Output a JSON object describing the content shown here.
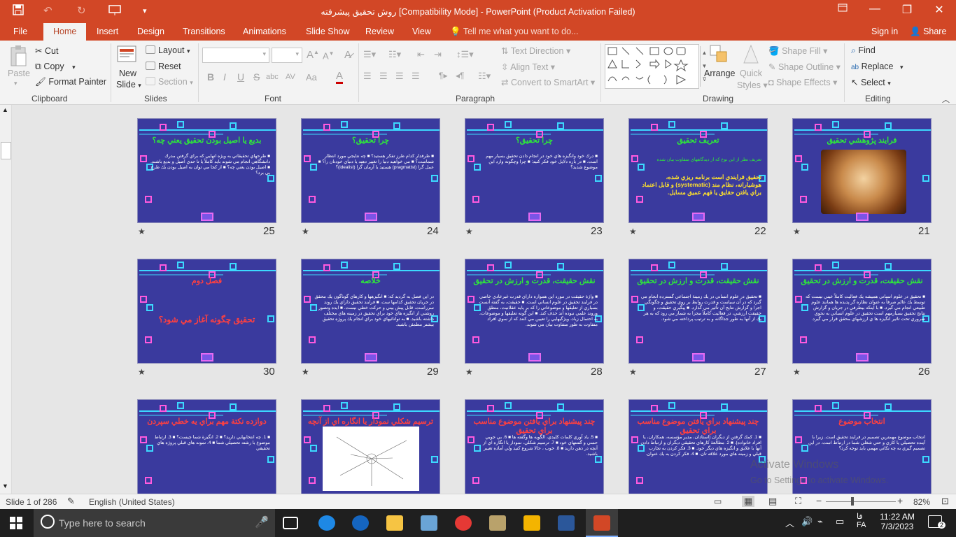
{
  "titlebar": {
    "title": "روش تحقیق پیشرفته [Compatibility Mode] - PowerPoint (Product Activation Failed)",
    "save_icon": "save-icon",
    "undo_icon": "undo-icon",
    "redo_icon": "redo-icon",
    "presenter_icon": "present-icon",
    "customize_icon": "chevron-down-icon",
    "ribbon_display": "□",
    "minimize": "—",
    "restore": "❐",
    "close": "✕"
  },
  "tabs": [
    "File",
    "Home",
    "Insert",
    "Design",
    "Transitions",
    "Animations",
    "Slide Show",
    "Review",
    "View"
  ],
  "active_tab": "Home",
  "tell_me": "Tell me what you want to do...",
  "signin": "Sign in",
  "share": "Share",
  "ribbon": {
    "clipboard": {
      "paste": "Paste",
      "cut": "Cut",
      "copy": "Copy",
      "format_painter": "Format Painter",
      "label": "Clipboard"
    },
    "slides": {
      "new_slide": "New",
      "new_slide2": "Slide",
      "layout": "Layout",
      "reset": "Reset",
      "section": "Section",
      "label": "Slides"
    },
    "font": {
      "label": "Font",
      "bold": "B",
      "italic": "I",
      "underline": "U",
      "strike": "S",
      "shadow": "abc",
      "spacing": "AV",
      "case": "Aa",
      "color": "A",
      "grow": "A",
      "shrink": "A"
    },
    "paragraph": {
      "label": "Paragraph",
      "text_direction": "Text Direction",
      "align_text": "Align Text",
      "convert": "Convert to SmartArt"
    },
    "drawing": {
      "label": "Drawing",
      "arrange": "Arrange",
      "quick_styles": "Quick",
      "quick_styles2": "Styles",
      "fill": "Shape Fill",
      "outline": "Shape Outline",
      "effects": "Shape Effects"
    },
    "editing": {
      "label": "Editing",
      "find": "Find",
      "replace": "Replace",
      "select": "Select"
    }
  },
  "slides": [
    {
      "num": "25",
      "title": "بديع يا اصيل بودن تحقيق يعني چه؟",
      "body": "■ طرحهاي تحقيقاتي به ويژه انهايي كه براي گرفتن مدرك دانشگاهي انجام مي شوند بايد كاملاً يا تا حدي اصيل و بديع باشند. ■ اصيل بودن يعني چه؟ ■ از كجا مي توان به اصيل بودن يك طرح پي برد؟"
    },
    {
      "num": "24",
      "title": "چرا تحقيق؟",
      "body": "■ طرفدار كدام طرز تفكر هستيد؟ ■ چه نتايجي مورد انتظار شماست؟ ■ مي خواهيد دنيا را تغيير دهيد يا دنياي خودتان را؟ ■ عمل گرا (pragmatist) هستيد يا آرمان گرا (idealist)؟"
    },
    {
      "num": "23",
      "title": "چرا تحقيق؟",
      "body": "■ درك خود وانگيزه هاي خود در انجام دادن تحقيق بسيار مهم است. ■ در باره دلايل خود فكر كنيد: ■ چرا وچگونه وارد اين موضوع شديد؟"
    },
    {
      "num": "22",
      "title": "تعريف تحقيق",
      "body": "تحقيق فرايندي است برنامه ريزي شده، هوشيارانه، نظام مند (systematic) و قابل اعتماد براي يافتن حقايق يا فهم عميق مسايل.",
      "yellow": true,
      "sub": "تعريف نظر از اين نوع كه از ديدگاههاي متفاوت بيان شده"
    },
    {
      "num": "21",
      "title": "فرايند پژوهشي تحقيق",
      "image": true
    },
    {
      "num": "30",
      "title": "فصل دوم",
      "body": "تحقيق چگونه آغاز مي شود؟",
      "red": true,
      "big": true
    },
    {
      "num": "29",
      "title": "خلاصه",
      "body": "در اين فصل به گرديد كه: ■ انگيزهها و كارهاي گوناگون يك محقق در جريان تحقيق كدامها ست. ■ فرايند تحقيق داراي يك روند سرراست، قابل پيش بيني و حركت خطي نيست. ■ ايده وتصور روشني از انگيزه هاي خود براي تحقيق در زمينه هاي مختلف داشته باشيد. ■ به توانائيهاي خود براي انجام يك پروژه تحقيق بيشتر مطمئن باشيد."
    },
    {
      "num": "28",
      "title": "نقش حقيقت، قدرت و ارزش در تحقيق",
      "body": "■ واژة حقيقت در مورد اين همواره داراي قدرت غيرعادي خاصي در فرايند تحقيق در علوم انساني است. ■ حقيقت، به گفتة آنست بسياري از تعليقها و موضوعاتي را كه بر پايه عقلانيت، منطق وروند علمي نبوده اند حذف كند. ■ اين گونه تعليقها و موضوعات، به احتمال زياد، ويژگيهايي را تعيين مي كنند كه از سوي افراد متفاوت به طور متفاوت بيان مي شوند."
    },
    {
      "num": "27",
      "title": "نقش حقيقت، قدرت و ارزش در تحقيق",
      "body": "■ تحقيق در علوم انساني در يك زمينة اجتماعي گسترده انجام مي گيرد كه در آن سياست و قدرت روابط بر روي تحقيق و چگونگي اجرا و گزارش نتايج آن تأثير مي گذارد. ■ پيگيري حقيقت، و حقيقت ارزشي، در فعاليت كاملاً مجزا به شمار مي رود كه به هر يك از آنها به طور جداگانه و به ترتيب پرداخته مي شود."
    },
    {
      "num": "26",
      "title": "نقش حقيقت، قدرت و ارزش در تحقيق",
      "body": "■ تحقيق در علوم انساني هميشه يك فعاليت كاملاً عيني نيست كه توسط يك عالم صرفاً به عنوان نظاره گر پديده ها همانند علوم طبيعي انجام مي گيرد. ■ با اينكه بيطرفي در جريان و گزارش نتايج تحقيق بسيارمهم است تحقيق در علوم انساني به نحوي ضروري تحت تاثير انگيزه ها ي ارزشهاي محقق قرار مي گيرد."
    },
    {
      "num": "",
      "title": "دوازده نكتة مهم براي يه خطي سپردن",
      "body": "■ 1. چه انتخابهايي داريد؟ ■ 2. انگيزة شما چيست؟ ■ 3. ارتباط موضوع با رشته تحصيلي شما ■ 4. نمونه هاي قبلي پروژه هاي تحقيقي",
      "red": true
    },
    {
      "num": "",
      "title": "ترسيم شكلي نمودار يا انگاره اي از آنچه در ذهن داريد",
      "diagram": true,
      "red": true
    },
    {
      "num": "",
      "title": "چند پيشنهاد براي يافتن موضوع مناسب براي تحقيق",
      "body": "■ 5. ياد آوري كلمات كليدي، الگويه ها وگفته ها ■ 6. بي جويي حسي و گفتنهاي خود ■ 7. ترسيم شكلي، نمودار يا انگاره اي از آنچه در ذهن داريد ■ 8. خوب ، حالا شروع كنيد ولي آماده تغيير باشيد.",
      "red": true
    },
    {
      "num": "",
      "title": "چند پيشنهاد براي يافتن موضوع مناسب براي تحقيق",
      "body": "■ 1. كمك گرفتن از ديگران (استادان، مدير مؤسسه، همكاران، يا افراد خانواده). ■ 2. مطالعة كارهاي تحقيقي ديگران و ارتباط دادن آنها با علايق و انگيزه هاي ديگر خود. ■ 3. فكر كردن به تجارب قبلي و زمينه هاي مورد علاقه تان. ■ 4. فكر كردن به يك عنوان.",
      "red": true
    },
    {
      "num": "",
      "title": "انتخاب موضوع",
      "body": "انتخاب موضوع مهمترين تصميم در فرايند تحقيق است. زيرا با آينده تحصيلي يا كاري و حتي شغلي شما در ارتباط است. در اين تصميم گيري به چه نكاتي مهمي بايد توجه كرد؟",
      "red": true
    }
  ],
  "watermark": {
    "line1": "Activate Windows",
    "line2": "Go to Settings to activate Windows."
  },
  "status": {
    "slide": "Slide 1 of 286",
    "language": "English (United States)",
    "zoom": "82%",
    "minus": "−",
    "plus": "+"
  },
  "taskbar": {
    "search": "Type here to search",
    "time": "11:22 AM",
    "date": "7/3/2023",
    "lang1": "فا",
    "lang2": "FA",
    "notifications": "2"
  }
}
